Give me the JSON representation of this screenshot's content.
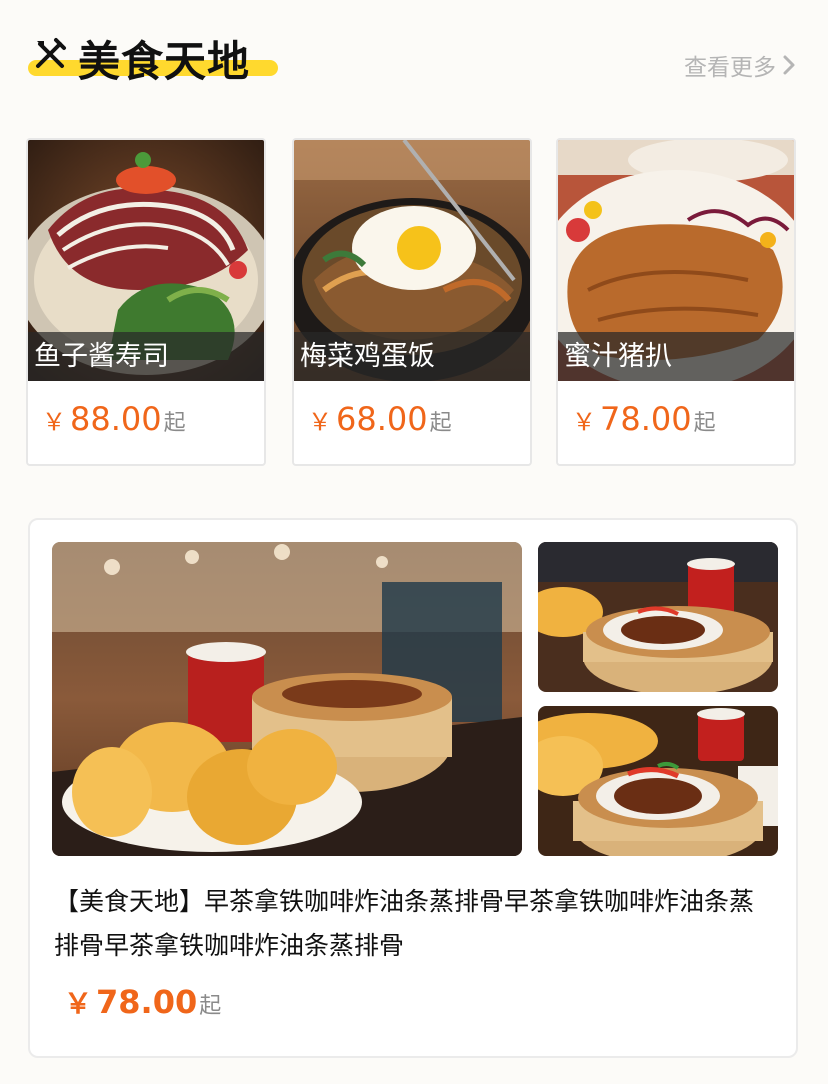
{
  "section": {
    "title": "美食天地",
    "more_label": "查看更多",
    "icon": "utensils-icon",
    "accent_color": "#ffd92e"
  },
  "top_items": [
    {
      "name": "鱼子酱寿司",
      "currency": "￥",
      "price": "88.00",
      "suffix": "起",
      "image": "salmon-salad-photo"
    },
    {
      "name": "梅菜鸡蛋饭",
      "currency": "￥",
      "price": "68.00",
      "suffix": "起",
      "image": "egg-rice-bowl-photo"
    },
    {
      "name": "蜜汁猪扒",
      "currency": "￥",
      "price": "78.00",
      "suffix": "起",
      "image": "pork-chop-photo"
    }
  ],
  "featured": {
    "description": "【美食天地】早茶拿铁咖啡炸油条蒸排骨早茶拿铁咖啡炸油条蒸排骨早茶拿铁咖啡炸油条蒸排骨",
    "currency": "￥",
    "price": "78.00",
    "suffix": "起",
    "price_color": "#f0661a"
  }
}
